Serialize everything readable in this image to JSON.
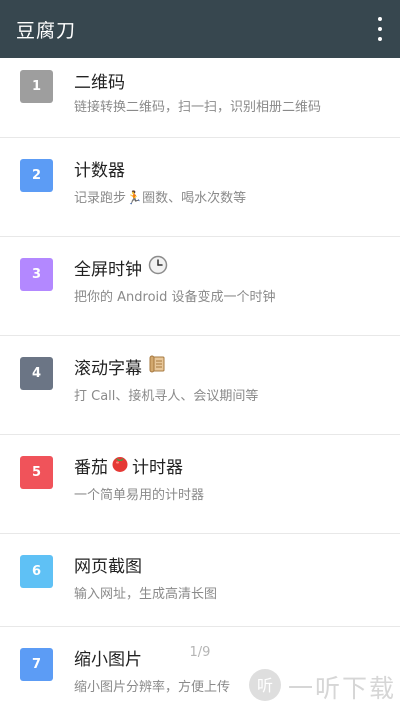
{
  "app": {
    "title": "豆腐刀"
  },
  "items": [
    {
      "num": "1",
      "color": "#9e9e9e",
      "title": "二维码",
      "subtitle": "链接转换二维码，扫一扫，识别相册二维码"
    },
    {
      "num": "2",
      "color": "#5c9cf5",
      "title": "计数器",
      "subtitle": "记录跑步🏃圈数、喝水次数等"
    },
    {
      "num": "3",
      "color": "#b388ff",
      "title": "全屏时钟",
      "subtitle": "把你的 Android 设备变成一个时钟"
    },
    {
      "num": "4",
      "color": "#6b7585",
      "title": "滚动字幕",
      "subtitle": "打 Call、接机寻人、会议期间等"
    },
    {
      "num": "5",
      "color": "#f0535a",
      "title_a": "番茄",
      "title_b": "计时器",
      "subtitle": "一个简单易用的计时器"
    },
    {
      "num": "6",
      "color": "#5fc1f5",
      "title": "网页截图",
      "subtitle": "输入网址，生成高清长图"
    },
    {
      "num": "7",
      "color": "#5c9cf5",
      "title": "缩小图片",
      "subtitle": "缩小图片分辨率，方便上传"
    }
  ],
  "pager": "1/9",
  "watermark": {
    "text": "一听下载"
  },
  "icons": {
    "more": "more-vert-icon",
    "clock": "clock-icon",
    "scroll": "scroll-icon",
    "tomato": "tomato-icon",
    "logo": "yiting-logo-icon"
  }
}
